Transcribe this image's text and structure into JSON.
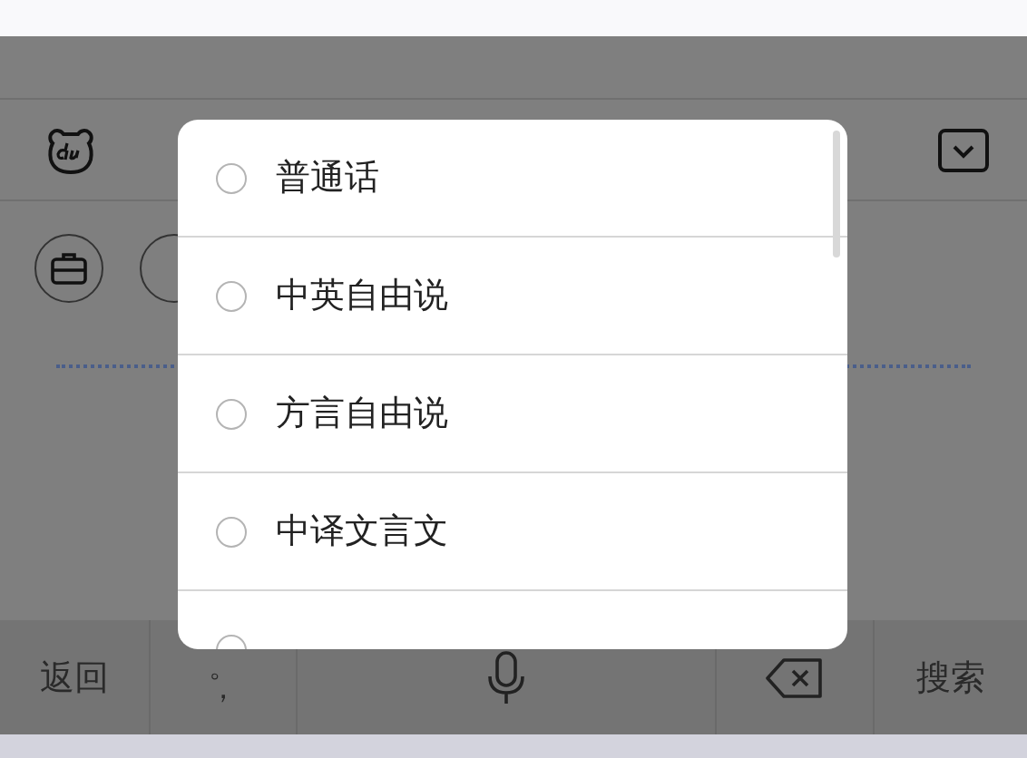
{
  "menu": {
    "options": [
      {
        "label": "普通话",
        "selected": false
      },
      {
        "label": "中英自由说",
        "selected": false
      },
      {
        "label": "方言自由说",
        "selected": false
      },
      {
        "label": "中译文言文",
        "selected": false
      },
      {
        "selected": false
      }
    ]
  },
  "keyboard": {
    "return_key": "返回",
    "punctuation_top": "。",
    "punctuation_bottom": "，",
    "search_key": "搜索"
  }
}
